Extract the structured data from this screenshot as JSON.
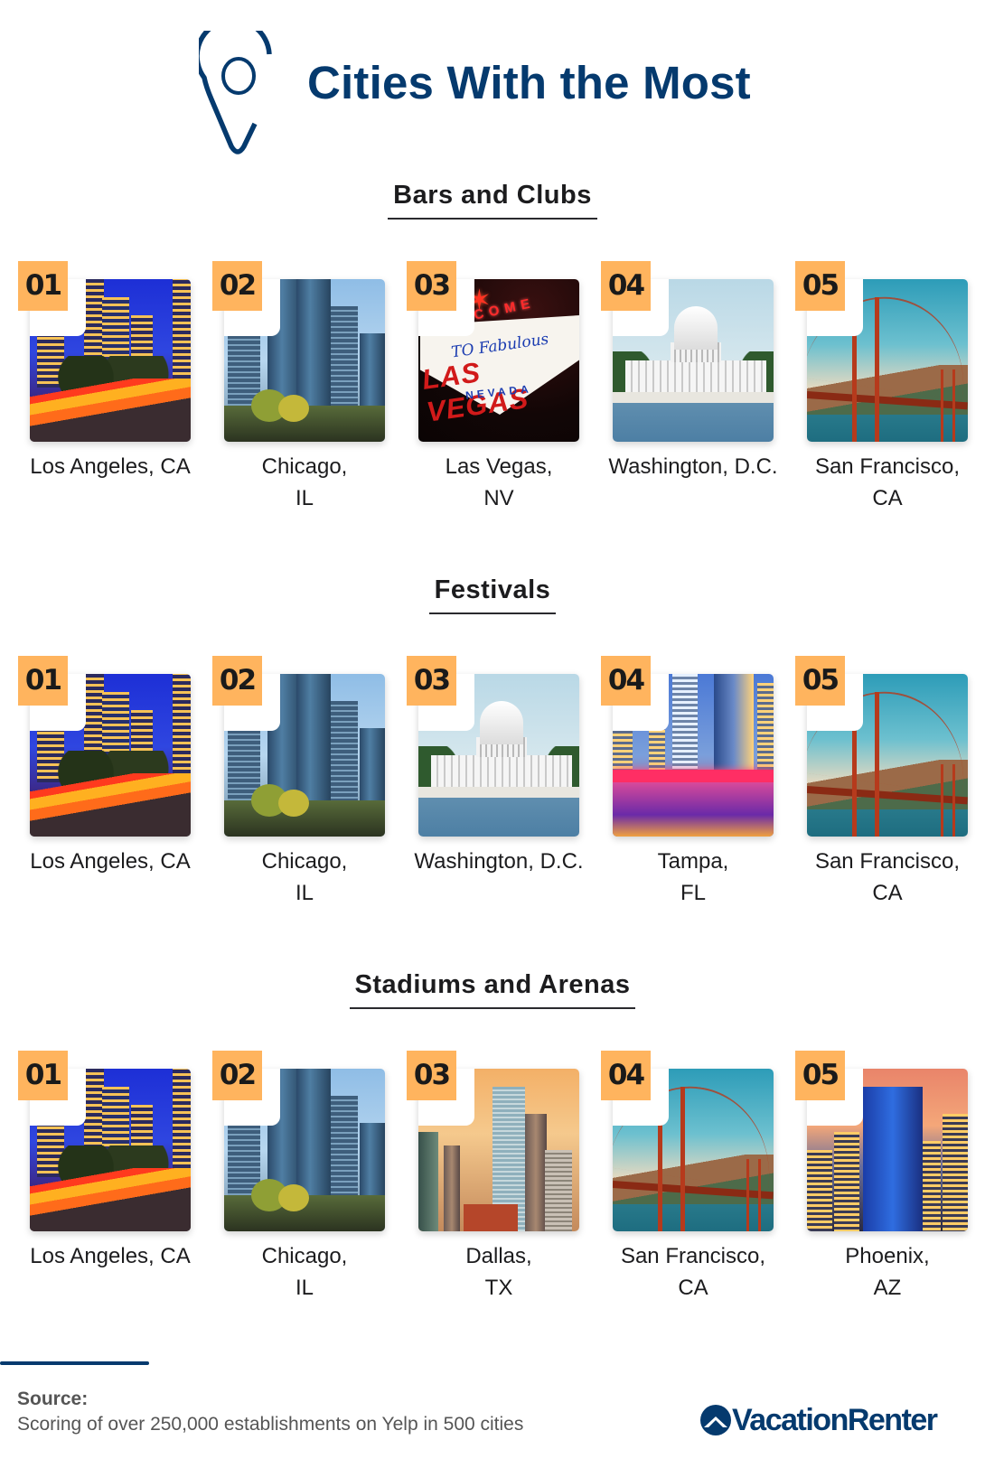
{
  "header": {
    "title": "Cities With the Most",
    "icon": "map-pin-icon",
    "accent_color": "#053a6e"
  },
  "badge_color": "#ffb45e",
  "sections": [
    {
      "heading": "Bars and Clubs",
      "cities": [
        {
          "rank": "01",
          "line1": "Los Angeles, CA",
          "line2": "",
          "scene": "los-angeles"
        },
        {
          "rank": "02",
          "line1": "Chicago,",
          "line2": "IL",
          "scene": "chicago"
        },
        {
          "rank": "03",
          "line1": "Las Vegas,",
          "line2": "NV",
          "scene": "las-vegas"
        },
        {
          "rank": "04",
          "line1": "Washington, D.C.",
          "line2": "",
          "scene": "washington-dc"
        },
        {
          "rank": "05",
          "line1": "San Francisco,",
          "line2": "CA",
          "scene": "san-francisco"
        }
      ]
    },
    {
      "heading": "Festivals",
      "cities": [
        {
          "rank": "01",
          "line1": "Los Angeles, CA",
          "line2": "",
          "scene": "los-angeles"
        },
        {
          "rank": "02",
          "line1": "Chicago,",
          "line2": "IL",
          "scene": "chicago"
        },
        {
          "rank": "03",
          "line1": "Washington, D.C.",
          "line2": "",
          "scene": "washington-dc"
        },
        {
          "rank": "04",
          "line1": "Tampa,",
          "line2": "FL",
          "scene": "tampa"
        },
        {
          "rank": "05",
          "line1": "San Francisco,",
          "line2": "CA",
          "scene": "san-francisco"
        }
      ]
    },
    {
      "heading": "Stadiums and Arenas",
      "cities": [
        {
          "rank": "01",
          "line1": "Los Angeles, CA",
          "line2": "",
          "scene": "los-angeles"
        },
        {
          "rank": "02",
          "line1": "Chicago,",
          "line2": "IL",
          "scene": "chicago"
        },
        {
          "rank": "03",
          "line1": "Dallas,",
          "line2": "TX",
          "scene": "dallas"
        },
        {
          "rank": "04",
          "line1": "San Francisco,",
          "line2": "CA",
          "scene": "san-francisco"
        },
        {
          "rank": "05",
          "line1": "Phoenix,",
          "line2": "AZ",
          "scene": "phoenix"
        }
      ]
    }
  ],
  "vegas_sign": {
    "welcome": "WELCOME",
    "to_fabulous": "TO Fabulous",
    "las_vegas": "LAS VEGAS",
    "nevada": "NEVADA"
  },
  "footer": {
    "source_label": "Source:",
    "source_text": "Scoring of over 250,000 establishments on Yelp in 500 cities",
    "logo_text": "VacationRenter"
  }
}
